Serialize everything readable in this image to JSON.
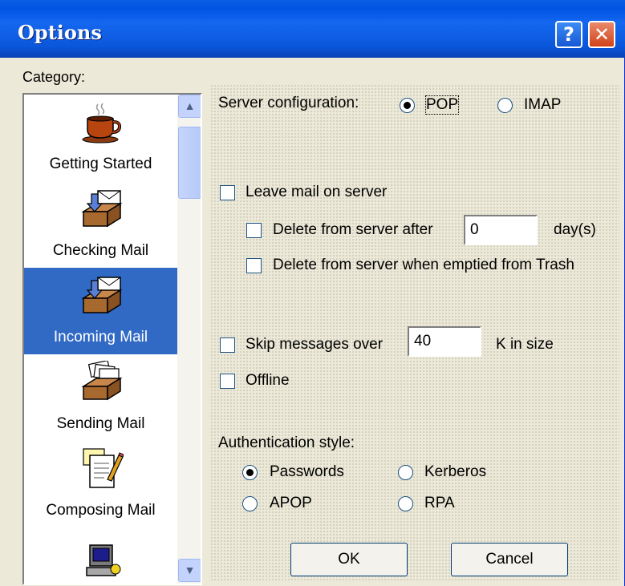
{
  "window": {
    "title": "Options",
    "help_icon": "question-mark-icon",
    "close_icon": "close-x-icon"
  },
  "category": {
    "label": "Category:",
    "items": [
      {
        "label": "Getting Started",
        "icon": "coffee-cup-icon",
        "selected": false
      },
      {
        "label": "Checking Mail",
        "icon": "inbox-tray-icon",
        "selected": false
      },
      {
        "label": "Incoming Mail",
        "icon": "inbox-tray-icon",
        "selected": true
      },
      {
        "label": "Sending Mail",
        "icon": "outbox-tray-icon",
        "selected": false
      },
      {
        "label": "Composing Mail",
        "icon": "notepad-pencil-icon",
        "selected": false
      },
      {
        "label": "",
        "icon": "computer-icon",
        "selected": false
      }
    ]
  },
  "server": {
    "label": "Server configuration:",
    "options": [
      {
        "label": "POP",
        "checked": true
      },
      {
        "label": "IMAP",
        "checked": false
      }
    ]
  },
  "leave_mail": {
    "label": "Leave mail on server",
    "checked": false
  },
  "delete_after": {
    "label": "Delete from server after",
    "value": "0",
    "unit": "day(s)",
    "checked": false
  },
  "delete_trash": {
    "label": "Delete from server when emptied from Trash",
    "checked": false
  },
  "skip_messages": {
    "label": "Skip messages over",
    "value": "40",
    "unit": "K in size",
    "checked": false
  },
  "offline": {
    "label": "Offline",
    "checked": false
  },
  "auth": {
    "label": "Authentication style:",
    "options": [
      {
        "label": "Passwords",
        "checked": true
      },
      {
        "label": "Kerberos",
        "checked": false
      },
      {
        "label": "APOP",
        "checked": false
      },
      {
        "label": "RPA",
        "checked": false
      }
    ]
  },
  "buttons": {
    "ok": "OK",
    "cancel": "Cancel"
  },
  "colors": {
    "titlebar": "#0054e3",
    "selection": "#316ac5",
    "dialog_bg": "#ece9d8"
  }
}
